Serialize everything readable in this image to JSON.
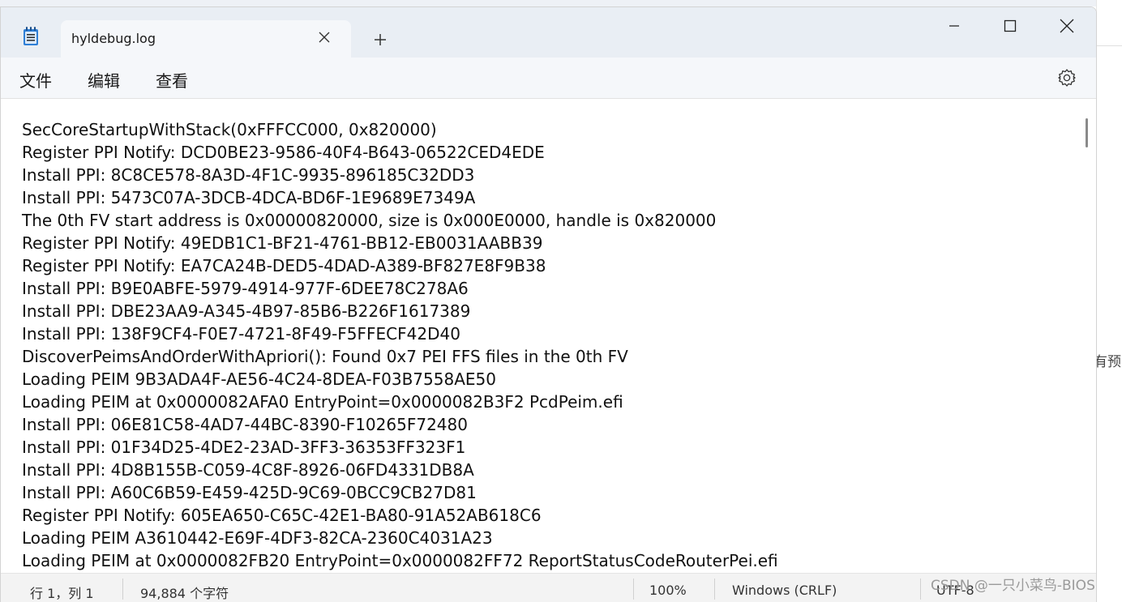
{
  "tab": {
    "title": "hyldebug.log"
  },
  "menu": {
    "items": [
      "文件",
      "编辑",
      "查看"
    ]
  },
  "editor": {
    "lines": [
      "SecCoreStartupWithStack(0xFFFCC000, 0x820000)",
      "Register PPI Notify: DCD0BE23-9586-40F4-B643-06522CED4EDE",
      "Install PPI: 8C8CE578-8A3D-4F1C-9935-896185C32DD3",
      "Install PPI: 5473C07A-3DCB-4DCA-BD6F-1E9689E7349A",
      "The 0th FV start address is 0x00000820000, size is 0x000E0000, handle is 0x820000",
      "Register PPI Notify: 49EDB1C1-BF21-4761-BB12-EB0031AABB39",
      "Register PPI Notify: EA7CA24B-DED5-4DAD-A389-BF827E8F9B38",
      "Install PPI: B9E0ABFE-5979-4914-977F-6DEE78C278A6",
      "Install PPI: DBE23AA9-A345-4B97-85B6-B226F1617389",
      "Install PPI: 138F9CF4-F0E7-4721-8F49-F5FFECF42D40",
      "DiscoverPeimsAndOrderWithApriori(): Found 0x7 PEI FFS files in the 0th FV",
      "Loading PEIM 9B3ADA4F-AE56-4C24-8DEA-F03B7558AE50",
      "Loading PEIM at 0x0000082AFA0 EntryPoint=0x0000082B3F2 PcdPeim.efi",
      "Install PPI: 06E81C58-4AD7-44BC-8390-F10265F72480",
      "Install PPI: 01F34D25-4DE2-23AD-3FF3-36353FF323F1",
      "Install PPI: 4D8B155B-C059-4C8F-8926-06FD4331DB8A",
      "Install PPI: A60C6B59-E459-425D-9C69-0BCC9CB27D81",
      "Register PPI Notify: 605EA650-C65C-42E1-BA80-91A52AB618C6",
      "Loading PEIM A3610442-E69F-4DF3-82CA-2360C4031A23",
      "Loading PEIM at 0x0000082FB20 EntryPoint=0x0000082FF72 ReportStatusCodeRouterPei.efi"
    ]
  },
  "status": {
    "position": "行 1，列 1",
    "char_count": "94,884 个字符",
    "zoom": "100%",
    "line_ending": "Windows (CRLF)",
    "encoding": "UTF-8"
  },
  "watermark": "CSDN @一只小菜鸟-BIOS",
  "background": {
    "text": "有预"
  },
  "icons": [
    "notepad-icon",
    "close-icon",
    "plus-icon",
    "minimize-icon",
    "maximize-icon",
    "gear-icon"
  ],
  "colors": {
    "titlebar": "#e9eef4",
    "tab": "#f5f7fa",
    "accent": "#1e6fd9"
  }
}
